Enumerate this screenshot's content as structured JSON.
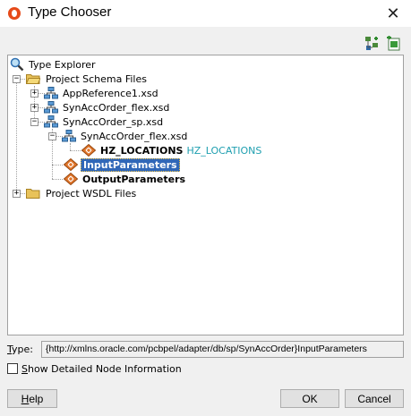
{
  "window": {
    "title": "Type Chooser",
    "close_glyph": "✕"
  },
  "toolbar": {
    "buttons": [
      {
        "icon": "expand-tree-icon"
      },
      {
        "icon": "import-schema-icon"
      }
    ]
  },
  "tree": {
    "root": {
      "label": "Type Explorer",
      "icon": "magnifier-icon"
    },
    "project_schema_files": {
      "label": "Project Schema Files",
      "expander": "−"
    },
    "app_reference": {
      "label": "AppReference1.xsd",
      "expander": "+"
    },
    "syn_flex": {
      "label": "SynAccOrder_flex.xsd",
      "expander": "+"
    },
    "syn_sp": {
      "label": "SynAccOrder_sp.xsd",
      "expander": "−"
    },
    "syn_sp_flex": {
      "label": "SynAccOrder_flex.xsd",
      "expander": "−"
    },
    "hz_locations": {
      "label": "HZ_LOCATIONS",
      "type": "HZ_LOCATIONS"
    },
    "input_parameters": {
      "label": "InputParameters",
      "selected": true
    },
    "output_parameters": {
      "label": "OutputParameters"
    },
    "project_wsdl_files": {
      "label": "Project WSDL Files",
      "expander": "+"
    }
  },
  "type_field": {
    "label_first": "T",
    "label_rest": "ype:",
    "value": "{http://xmlns.oracle.com/pcbpel/adapter/db/sp/SynAccOrder}InputParameters"
  },
  "detail_checkbox": {
    "label_first": "S",
    "label_rest": "how Detailed Node Information",
    "checked": false
  },
  "buttons": {
    "help_first": "H",
    "help_rest": "elp",
    "ok": "OK",
    "cancel": "Cancel"
  },
  "colors": {
    "selection": "#3067b8",
    "type_name": "#1f9fb0",
    "folder": "#e8c25a",
    "element_icon": "#e0752a"
  }
}
